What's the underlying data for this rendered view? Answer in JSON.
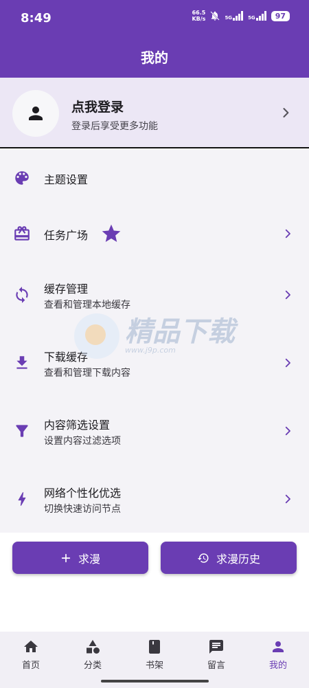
{
  "status_bar": {
    "time": "8:49",
    "net_speed_value": "66.5",
    "net_speed_unit": "KB/s",
    "sim1": "5G",
    "sim2": "5G",
    "battery": "97"
  },
  "app_bar": {
    "title": "我的"
  },
  "login": {
    "title": "点我登录",
    "subtitle": "登录后享受更多功能"
  },
  "menu": {
    "items": [
      {
        "title": "主题设置",
        "icon": "palette-icon"
      },
      {
        "title": "任务广场",
        "icon": "gift-icon",
        "badge_icon": "star-icon"
      },
      {
        "title": "缓存管理",
        "subtitle": "查看和管理本地缓存",
        "icon": "sync-icon"
      },
      {
        "title": "下载缓存",
        "subtitle": "查看和管理下载内容",
        "icon": "download-icon"
      },
      {
        "title": "内容筛选设置",
        "subtitle": "设置内容过滤选项",
        "icon": "filter-icon"
      },
      {
        "title": "网络个性化优选",
        "subtitle": "切换快速访问节点",
        "icon": "bolt-icon"
      }
    ]
  },
  "watermark": {
    "text": "精品下载",
    "url": "www.j9p.com"
  },
  "buttons": {
    "request": "求漫",
    "request_history": "求漫历史"
  },
  "bottom_nav": {
    "items": [
      {
        "label": "首页",
        "icon": "home-icon"
      },
      {
        "label": "分类",
        "icon": "category-icon"
      },
      {
        "label": "书架",
        "icon": "book-icon"
      },
      {
        "label": "留言",
        "icon": "message-icon"
      },
      {
        "label": "我的",
        "icon": "person-icon",
        "active": true
      }
    ]
  },
  "colors": {
    "primary": "#6a3db3",
    "icon_accent": "#6a3db3",
    "menu_bg": "#f4f3f7",
    "login_bg": "#ece7f5"
  }
}
